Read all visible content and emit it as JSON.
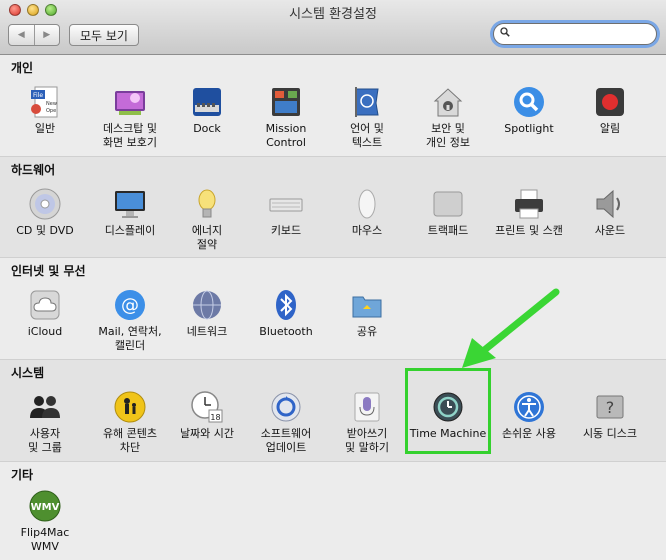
{
  "window": {
    "title": "시스템 환경설정"
  },
  "toolbar": {
    "back": "◀",
    "forward": "▶",
    "show_all": "모두 보기",
    "search_value": ""
  },
  "sections": [
    {
      "title": "개인",
      "items": [
        {
          "label": "일반"
        },
        {
          "label": "데스크탑 및\n화면 보호기"
        },
        {
          "label": "Dock"
        },
        {
          "label": "Mission\nControl"
        },
        {
          "label": "언어 및\n텍스트"
        },
        {
          "label": "보안 및\n개인 정보"
        },
        {
          "label": "Spotlight"
        },
        {
          "label": "알림"
        }
      ]
    },
    {
      "title": "하드웨어",
      "items": [
        {
          "label": "CD 및 DVD"
        },
        {
          "label": "디스플레이"
        },
        {
          "label": "에너지\n절약"
        },
        {
          "label": "키보드"
        },
        {
          "label": "마우스"
        },
        {
          "label": "트랙패드"
        },
        {
          "label": "프린트 및 스캔"
        },
        {
          "label": "사운드"
        }
      ]
    },
    {
      "title": "인터넷 및 무선",
      "items": [
        {
          "label": "iCloud"
        },
        {
          "label": "Mail, 연락처,\n캘린더"
        },
        {
          "label": "네트워크"
        },
        {
          "label": "Bluetooth"
        },
        {
          "label": "공유"
        }
      ]
    },
    {
      "title": "시스템",
      "items": [
        {
          "label": "사용자\n및 그룹"
        },
        {
          "label": "유해 콘텐츠\n차단"
        },
        {
          "label": "날짜와 시간"
        },
        {
          "label": "소프트웨어\n업데이트"
        },
        {
          "label": "받아쓰기\n및 말하기"
        },
        {
          "label": "Time Machine"
        },
        {
          "label": "손쉬운 사용"
        },
        {
          "label": "시동 디스크"
        }
      ]
    },
    {
      "title": "기타",
      "items": [
        {
          "label": "Flip4Mac\nWMV"
        }
      ]
    }
  ],
  "icon_names": {
    "general": "general-icon",
    "desktop": "desktop-icon",
    "dock": "dock-icon",
    "mission": "mission-control-icon",
    "language": "flag-icon",
    "security": "house-lock-icon",
    "spotlight": "magnifier-icon",
    "notifications": "red-dot-icon"
  },
  "date_icon_text": "18",
  "flip4mac_badge": "WMV",
  "colors": {
    "highlight": "#34d12e",
    "search_ring": "#7aa7e6"
  }
}
